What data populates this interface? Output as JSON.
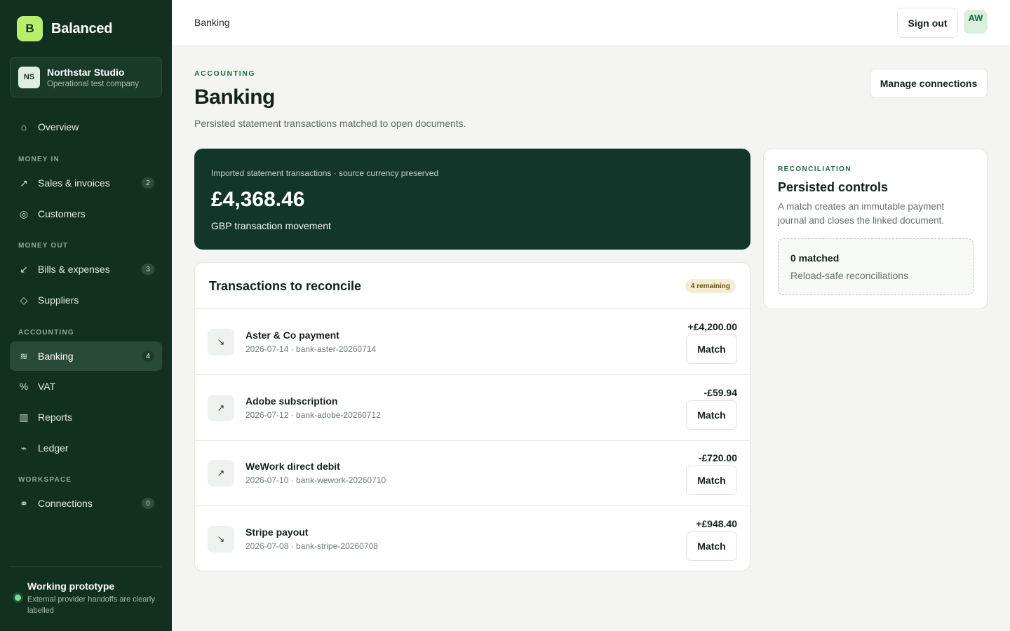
{
  "brand": {
    "mark": "B",
    "name": "Balanced"
  },
  "company": {
    "initials": "NS",
    "name": "Northstar Studio",
    "subtitle": "Operational test company"
  },
  "sidebar": {
    "sections": {
      "money_in": "MONEY IN",
      "money_out": "MONEY OUT",
      "accounting": "ACCOUNTING",
      "workspace": "WORKSPACE"
    },
    "items": [
      {
        "label": "Overview",
        "icon": "home-icon",
        "glyph": "⌂"
      },
      {
        "label": "Sales & invoices",
        "icon": "arrow-up-right-icon",
        "glyph": "↗",
        "badge": "2"
      },
      {
        "label": "Customers",
        "icon": "target-icon",
        "glyph": "◎"
      },
      {
        "label": "Bills & expenses",
        "icon": "arrow-down-left-icon",
        "glyph": "↙",
        "badge": "3"
      },
      {
        "label": "Suppliers",
        "icon": "diamond-icon",
        "glyph": "◇"
      },
      {
        "label": "Banking",
        "icon": "waves-icon",
        "glyph": "≋",
        "badge": "4",
        "active": true
      },
      {
        "label": "VAT",
        "icon": "percent-icon",
        "glyph": "%"
      },
      {
        "label": "Reports",
        "icon": "columns-icon",
        "glyph": "▥"
      },
      {
        "label": "Ledger",
        "icon": "trend-icon",
        "glyph": "⌁"
      },
      {
        "label": "Connections",
        "icon": "link-icon",
        "glyph": "⚭",
        "badge": "0"
      }
    ],
    "footer": {
      "title": "Working prototype",
      "subtitle": "External provider handoffs are clearly labelled"
    }
  },
  "topbar": {
    "breadcrumb": "Banking",
    "sign_out": "Sign out",
    "avatar": "AW"
  },
  "page": {
    "eyebrow": "ACCOUNTING",
    "title": "Banking",
    "subtitle": "Persisted statement transactions matched to open documents.",
    "manage_button": "Manage connections"
  },
  "summary": {
    "caption": "Imported statement transactions · source currency preserved",
    "amount": "£4,368.46",
    "label": "GBP transaction movement"
  },
  "transactions": {
    "title": "Transactions to reconcile",
    "remaining": "4 remaining",
    "match_label": "Match",
    "rows": [
      {
        "name": "Aster & Co payment",
        "meta": "2026-07-14 · bank-aster-20260714",
        "amount": "+£4,200.00",
        "icon": "arrow-down-right-icon",
        "glyph": "↘"
      },
      {
        "name": "Adobe subscription",
        "meta": "2026-07-12 · bank-adobe-20260712",
        "amount": "-£59.94",
        "icon": "arrow-up-right-icon",
        "glyph": "↗"
      },
      {
        "name": "WeWork direct debit",
        "meta": "2026-07-10 · bank-wework-20260710",
        "amount": "-£720.00",
        "icon": "arrow-up-right-icon",
        "glyph": "↗"
      },
      {
        "name": "Stripe payout",
        "meta": "2026-07-08 · bank-stripe-20260708",
        "amount": "+£948.40",
        "icon": "arrow-down-right-icon",
        "glyph": "↘"
      }
    ]
  },
  "reconciliation": {
    "eyebrow": "RECONCILIATION",
    "title": "Persisted controls",
    "description": "A match creates an immutable payment journal and closes the linked document.",
    "count": "0 matched",
    "note": "Reload-safe reconciliations"
  },
  "colors": {
    "sidebar": "#12301f",
    "accent": "#b9ee6d",
    "summary": "#12362a",
    "status_dot": "#74e08f"
  }
}
